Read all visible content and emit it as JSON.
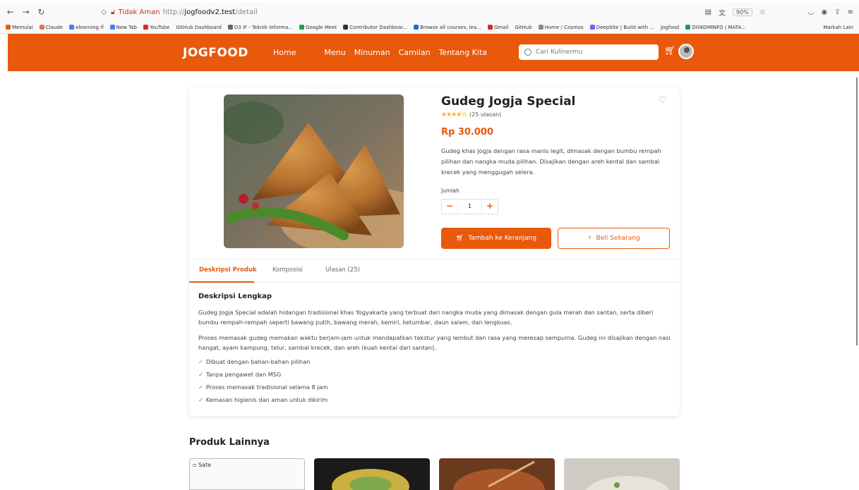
{
  "browser": {
    "security_label": "Tidak Aman",
    "url_prefix": "http://",
    "url_host": "jogfoodv2.test",
    "url_path": "/detail",
    "zoom": "90%"
  },
  "bookmarks": [
    {
      "label": "Memulai",
      "color": "#e8590c"
    },
    {
      "label": "Claude",
      "color": "#d97757"
    },
    {
      "label": "elearning if",
      "color": "#3b82f6"
    },
    {
      "label": "New Tab",
      "color": "#3b82f6"
    },
    {
      "label": "YouTube",
      "color": "#dc2626"
    },
    {
      "label": "GitHub Dashboard",
      "color": ""
    },
    {
      "label": "D3 IF - Teknik Informa...",
      "color": "#666666"
    },
    {
      "label": "Google Meet",
      "color": "#16a34a"
    },
    {
      "label": "Contributor Dashboar...",
      "color": "#333333"
    },
    {
      "label": "Browse all courses, lea...",
      "color": "#2563eb"
    },
    {
      "label": "Gmail",
      "color": "#dc2626"
    },
    {
      "label": "GitHub",
      "color": ""
    },
    {
      "label": "Home / Cosmos",
      "color": "#888888"
    },
    {
      "label": "DeepSite | Build with ...",
      "color": "#6366f1"
    },
    {
      "label": "Jogfood",
      "color": ""
    },
    {
      "label": "DISKOMINFO | MATA...",
      "color": "#16a34a"
    }
  ],
  "bookmarks_other": "Markah Lain",
  "header": {
    "logo": "JOGFOOD",
    "menu": [
      "Home",
      "Menu",
      "Minuman",
      "Camilan",
      "Tentang Kita"
    ],
    "search_placeholder": "Cari Kulinermu",
    "accent": "#e8590c"
  },
  "product": {
    "title": "Gudeg Jogja Special",
    "stars": "★★★★½",
    "rating": 4.5,
    "reviews": "(25 ulasan)",
    "price": "Rp 30.000",
    "description": "Gudeg khas Jogja dengan rasa manis legit, dimasak dengan bumbu rempah pilihan dan nangka muda pilihan. Disajikan dengan areh kental dan sambal krecek yang menggugah selera.",
    "qty_label": "Jumlah",
    "qty": "1",
    "add_to_cart": "Tambah ke Keranjang",
    "buy_now": "Beli Sekarang"
  },
  "tabs": [
    "Deskripsi Produk",
    "Komposisi",
    "Ulasan (25)"
  ],
  "details": {
    "title": "Deskripsi Lengkap",
    "para1": "Gudeg Jogja Special adalah hidangan tradisional khas Yogyakarta yang terbuat dari nangka muda yang dimasak dengan gula merah dan santan, serta diberi bumbu rempah-rempah seperti bawang putih, bawang merah, kemiri, ketumbar, daun salam, dan lengkuas.",
    "para2": "Proses memasak gudeg memakan waktu berjam-jam untuk mendapatkan tekstur yang lembut dan rasa yang meresap sempurna. Gudeg ini disajikan dengan nasi hangat, ayam kampung, telur, sambal krecek, dan areh (kuah kental dari santan).",
    "features": [
      "Dibuat dengan bahan-bahan pilihan",
      "Tanpa pengawet dan MSG",
      "Proses memasak tradisional selama 8 jam",
      "Kemasan higienis dan aman untuk dikirim"
    ]
  },
  "other": {
    "title": "Produk Lainnya",
    "first_alt": "Sate"
  }
}
